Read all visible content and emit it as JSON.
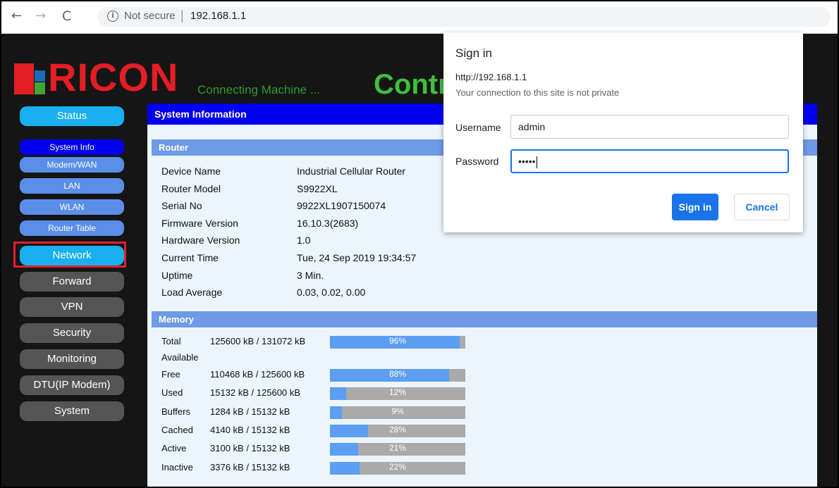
{
  "browser": {
    "security_text": "Not secure",
    "separator": "|",
    "url": "192.168.1.1",
    "back_glyph": "←",
    "forward_glyph": "→",
    "reload_glyph": "C",
    "info_glyph": "i"
  },
  "header": {
    "logo_text": "RICON",
    "tagline": "Connecting Machine ...",
    "title": "Contr",
    "brand_colors": {
      "red": "#e31e24",
      "green": "#3fa535",
      "blue": "#1a6bb3"
    }
  },
  "sidebar": {
    "status": "Status",
    "status_items": [
      "System Info",
      "Modem/WAN",
      "LAN",
      "WLAN",
      "Router Table"
    ],
    "active_item": "System Info",
    "network": "Network",
    "sections": [
      "Forward",
      "VPN",
      "Security",
      "Monitoring",
      "DTU(IP Modem)",
      "System"
    ]
  },
  "main": {
    "title": "System Information",
    "router": {
      "heading": "Router",
      "rows": [
        {
          "label": "Device Name",
          "value": "Industrial Cellular Router"
        },
        {
          "label": "Router Model",
          "value": "S9922XL"
        },
        {
          "label": "Serial No",
          "value": "9922XL1907150074"
        },
        {
          "label": "Firmware Version",
          "value": "16.10.3(2683)"
        },
        {
          "label": "Hardware Version",
          "value": "1.0"
        },
        {
          "label": "Current Time",
          "value": "Tue, 24 Sep 2019 19:34:57"
        },
        {
          "label": "Uptime",
          "value": "3 Min."
        },
        {
          "label": "Load Average",
          "value": "0.03, 0.02, 0.00"
        }
      ]
    },
    "memory": {
      "heading": "Memory",
      "rows": [
        {
          "label": "Total",
          "value": "125600 kB / 131072 kB",
          "percent_label": "96%",
          "percent": 96
        },
        {
          "label": "Available",
          "value": "",
          "percent_label": "",
          "percent": null
        },
        {
          "label": "Free",
          "value": "110468 kB / 125600 kB",
          "percent_label": "88%",
          "percent": 88
        },
        {
          "label": "Used",
          "value": "15132 kB / 125600 kB",
          "percent_label": "12%",
          "percent": 12
        },
        {
          "label": "Buffers",
          "value": "1284 kB / 15132 kB",
          "percent_label": "9%",
          "percent": 9
        },
        {
          "label": "Cached",
          "value": "4140 kB / 15132 kB",
          "percent_label": "28%",
          "percent": 28
        },
        {
          "label": "Active",
          "value": "3100 kB / 15132 kB",
          "percent_label": "21%",
          "percent": 21
        },
        {
          "label": "Inactive",
          "value": "3376 kB / 15132 kB",
          "percent_label": "22%",
          "percent": 22
        }
      ]
    }
  },
  "dialog": {
    "title": "Sign in",
    "url": "http://192.168.1.1",
    "note": "Your connection to this site is not private",
    "username_label": "Username",
    "username_value": "admin",
    "password_label": "Password",
    "password_value": "•••••",
    "sign_in": "Sign in",
    "cancel": "Cancel"
  }
}
